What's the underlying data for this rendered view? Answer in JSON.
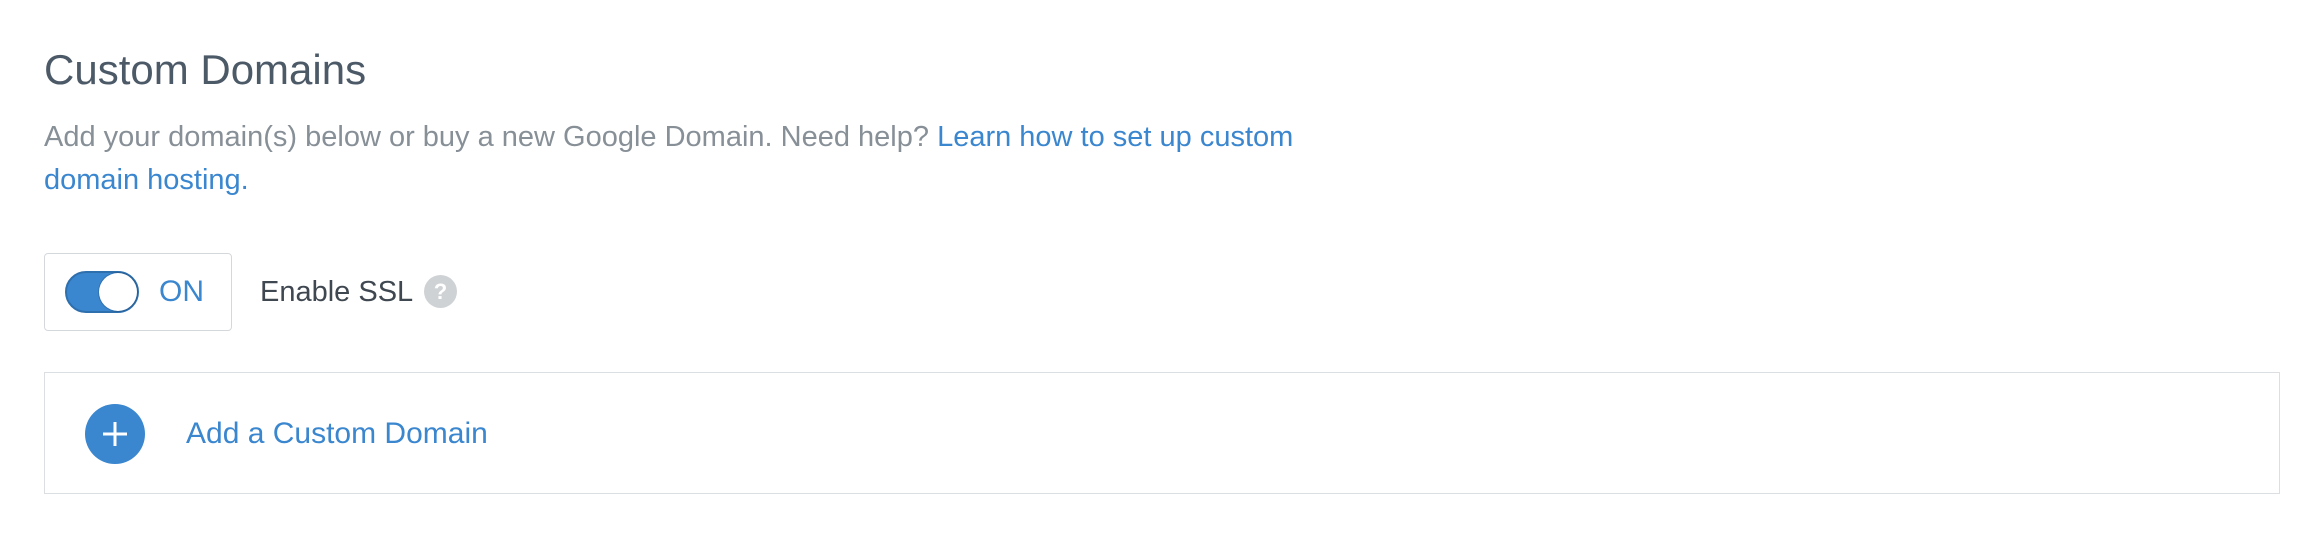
{
  "section": {
    "title": "Custom Domains",
    "description": "Add your domain(s) below or buy a new Google Domain. Need help? ",
    "help_link_text": "Learn how to set up custom domain hosting."
  },
  "ssl": {
    "toggle_state": "ON",
    "label": "Enable SSL",
    "help_glyph": "?"
  },
  "add_domain": {
    "label": "Add a Custom Domain"
  },
  "colors": {
    "accent": "#3a86cf",
    "title": "#4c5967",
    "muted_text": "#878f97",
    "border": "#dcdfe2",
    "help_icon_bg": "#cfd2d5"
  },
  "icons": {
    "help": "question-circle-icon",
    "add": "plus-circle-icon",
    "toggle": "toggle-switch"
  }
}
